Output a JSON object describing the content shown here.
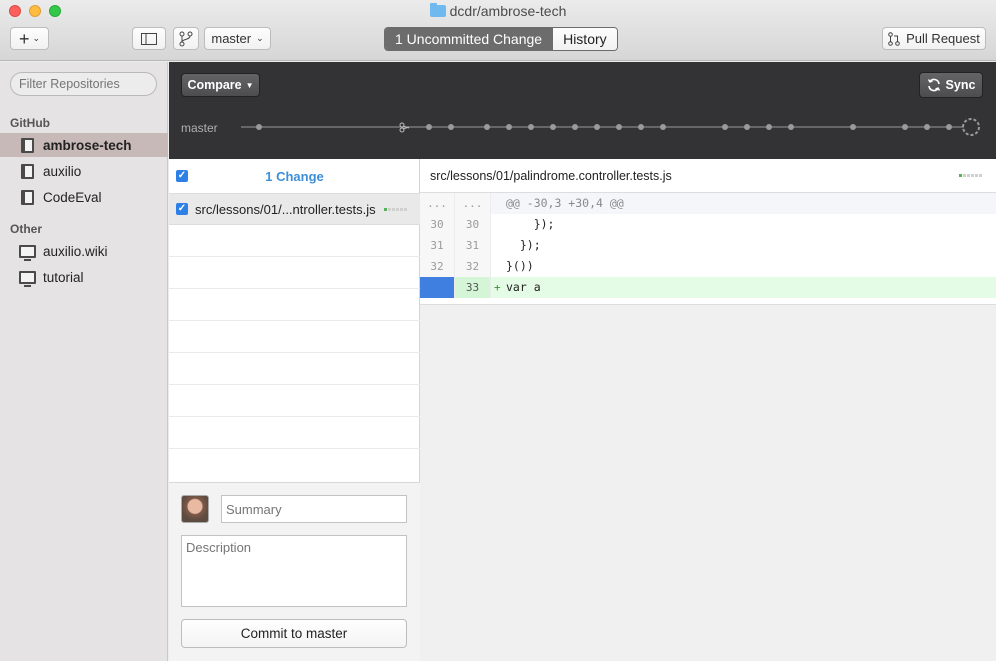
{
  "window": {
    "title": "dcdr/ambrose-tech"
  },
  "toolbar": {
    "add_label": "+",
    "branch_label": "master",
    "tabs": [
      {
        "label": "1 Uncommitted Change",
        "active": true
      },
      {
        "label": "History",
        "active": false
      }
    ],
    "pull_request_label": "Pull Request"
  },
  "sidebar": {
    "filter_placeholder": "Filter Repositories",
    "sections": [
      {
        "label": "GitHub",
        "items": [
          {
            "label": "ambrose-tech",
            "selected": true,
            "icon": "repo-icon"
          },
          {
            "label": "auxilio",
            "selected": false,
            "icon": "repo-icon"
          },
          {
            "label": "CodeEval",
            "selected": false,
            "icon": "repo-icon"
          }
        ]
      },
      {
        "label": "Other",
        "items": [
          {
            "label": "auxilio.wiki",
            "selected": false,
            "icon": "computer-icon"
          },
          {
            "label": "tutorial",
            "selected": false,
            "icon": "computer-icon"
          }
        ]
      }
    ]
  },
  "branchbar": {
    "compare_label": "Compare",
    "sync_label": "Sync",
    "branch_label": "master"
  },
  "changes": {
    "title": "1 Change",
    "files": [
      {
        "name": "src/lessons/01/...ntroller.tests.js",
        "checked": true
      }
    ]
  },
  "commit": {
    "summary_placeholder": "Summary",
    "description_placeholder": "Description",
    "button_label": "Commit to master"
  },
  "diff": {
    "path": "src/lessons/01/palindrome.controller.tests.js",
    "hunk_header": "@@ -30,3 +30,4 @@",
    "hunk_gutter": "...",
    "lines": [
      {
        "old": "30",
        "new": "30",
        "text": "    });",
        "type": "context"
      },
      {
        "old": "31",
        "new": "31",
        "text": "  });",
        "type": "context"
      },
      {
        "old": "32",
        "new": "32",
        "text": "}())",
        "type": "context"
      },
      {
        "old": "",
        "new": "33",
        "text": "var a",
        "type": "added"
      }
    ]
  },
  "colors": {
    "accent_blue": "#3d8fd8",
    "dark_bar": "#333335",
    "added_bg": "#e4fbe5"
  }
}
